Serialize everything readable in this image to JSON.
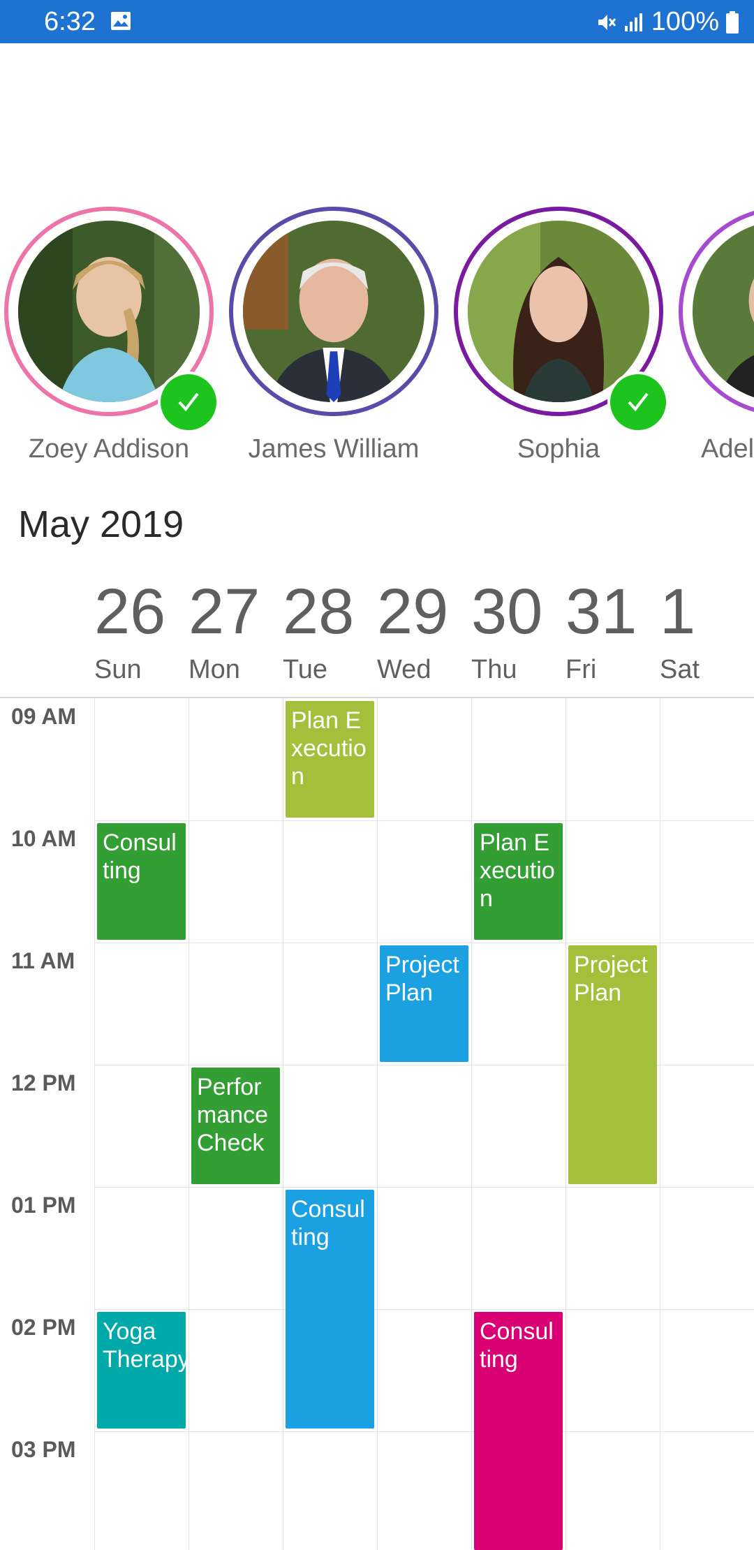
{
  "status_bar": {
    "time": "6:32",
    "battery": "100%",
    "color": "#1e73d2",
    "icons": [
      "image-icon",
      "mute-icon",
      "signal-icon",
      "battery-icon"
    ]
  },
  "resources": [
    {
      "name": "Zoey Addison",
      "ring_color": "#ec74a8",
      "checked": true
    },
    {
      "name": "James William",
      "ring_color": "#5b4aa8",
      "checked": false
    },
    {
      "name": "Sophia",
      "ring_color": "#7a1aa0",
      "checked": true
    },
    {
      "name": "Adel",
      "ring_color": "#a64bd0",
      "checked": false
    }
  ],
  "calendar": {
    "month_label": "May 2019",
    "days": [
      {
        "number": "26",
        "name": "Sun"
      },
      {
        "number": "27",
        "name": "Mon"
      },
      {
        "number": "28",
        "name": "Tue"
      },
      {
        "number": "29",
        "name": "Wed"
      },
      {
        "number": "30",
        "name": "Thu"
      },
      {
        "number": "31",
        "name": "Fri"
      },
      {
        "number": "1",
        "name": "Sat"
      }
    ],
    "times": [
      "09 AM",
      "10 AM",
      "11 AM",
      "12 PM",
      "01 PM",
      "02 PM",
      "03 PM"
    ],
    "appointments": [
      {
        "title": "Plan Execution",
        "day": "Tue",
        "start": "09 AM",
        "end": "10 AM",
        "color": "#a2c03a"
      },
      {
        "title": "Consulting",
        "day": "Sun",
        "start": "10 AM",
        "end": "11 AM",
        "color": "#339e33"
      },
      {
        "title": "Plan Execution",
        "day": "Thu",
        "start": "10 AM",
        "end": "11 AM",
        "color": "#339e33"
      },
      {
        "title": "Project Plan",
        "day": "Wed",
        "start": "11 AM",
        "end": "12 PM",
        "color": "#1ba1e2"
      },
      {
        "title": "Project Plan",
        "day": "Fri",
        "start": "11 AM",
        "end": "01 PM",
        "color": "#a2c03a"
      },
      {
        "title": "Performance Check",
        "day": "Mon",
        "start": "12 PM",
        "end": "01 PM",
        "color": "#339e33"
      },
      {
        "title": "Consulting",
        "day": "Tue",
        "start": "01 PM",
        "end": "03 PM",
        "color": "#1ba1e2"
      },
      {
        "title": "Yoga Therapy",
        "day": "Sun",
        "start": "02 PM",
        "end": "03 PM",
        "color": "#00a9a9"
      },
      {
        "title": "Consulting",
        "day": "Thu",
        "start": "02 PM",
        "end": "04 PM",
        "color": "#d80073"
      }
    ]
  }
}
